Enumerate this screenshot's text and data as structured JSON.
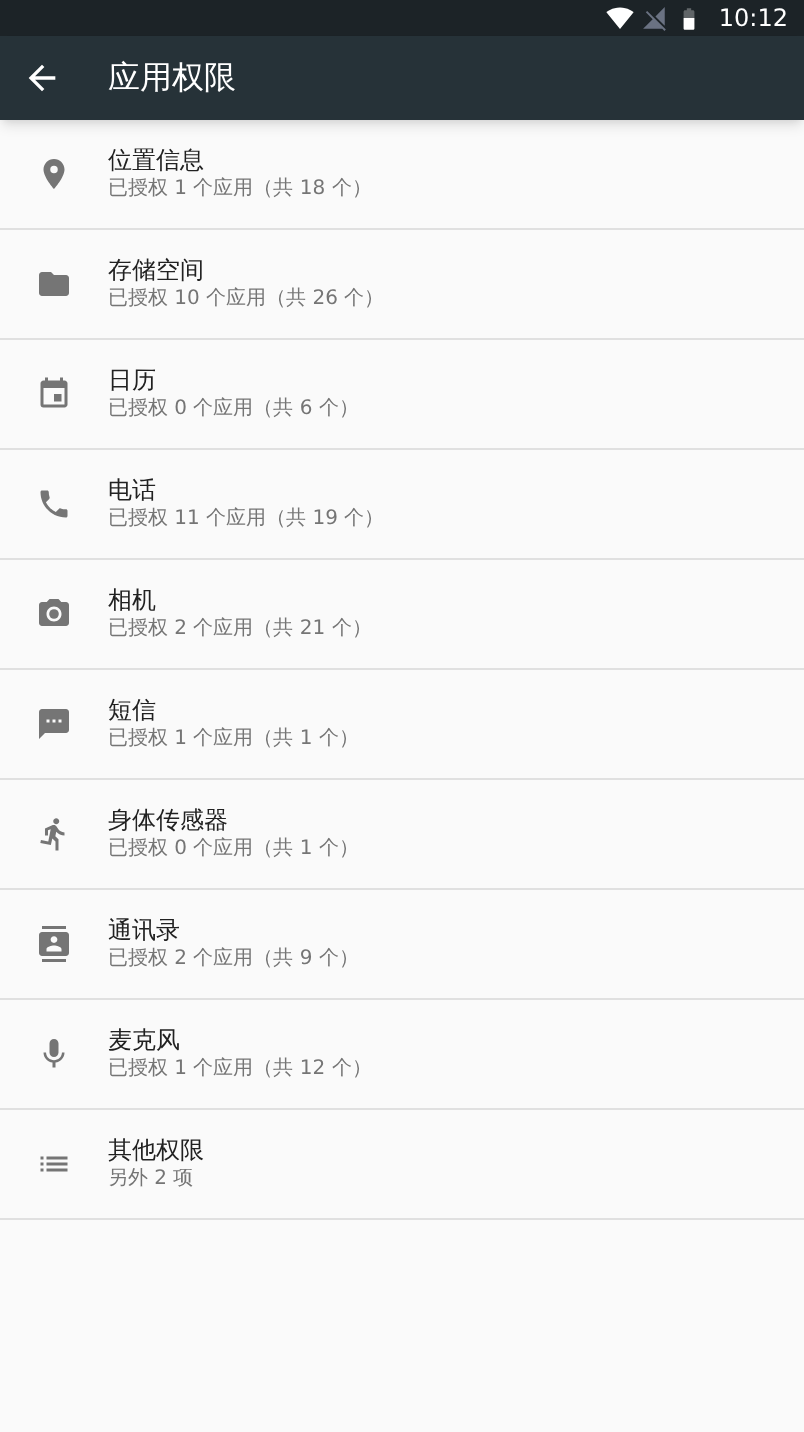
{
  "status_bar": {
    "time": "10:12"
  },
  "app_bar": {
    "title": "应用权限"
  },
  "permissions": [
    {
      "kind": "location",
      "title": "位置信息",
      "summary": "已授权 1 个应用（共 18 个）"
    },
    {
      "kind": "storage",
      "title": "存储空间",
      "summary": "已授权 10 个应用（共 26 个）"
    },
    {
      "kind": "calendar",
      "title": "日历",
      "summary": "已授权 0 个应用（共 6 个）"
    },
    {
      "kind": "phone",
      "title": "电话",
      "summary": "已授权 11 个应用（共 19 个）"
    },
    {
      "kind": "camera",
      "title": "相机",
      "summary": "已授权 2 个应用（共 21 个）"
    },
    {
      "kind": "sms",
      "title": "短信",
      "summary": "已授权 1 个应用（共 1 个）"
    },
    {
      "kind": "sensors",
      "title": "身体传感器",
      "summary": "已授权 0 个应用（共 1 个）"
    },
    {
      "kind": "contacts",
      "title": "通讯录",
      "summary": "已授权 2 个应用（共 9 个）"
    },
    {
      "kind": "microphone",
      "title": "麦克风",
      "summary": "已授权 1 个应用（共 12 个）"
    },
    {
      "kind": "other",
      "title": "其他权限",
      "summary": "另外 2 项"
    }
  ]
}
